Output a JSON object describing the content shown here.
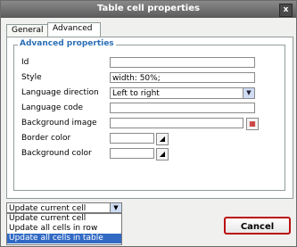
{
  "window": {
    "title": "Table cell properties",
    "close_label": "x"
  },
  "tabs": [
    {
      "label": "General"
    },
    {
      "label": "Advanced"
    }
  ],
  "advanced": {
    "section_title": "Advanced properties",
    "fields": {
      "id": {
        "label": "Id",
        "value": ""
      },
      "style": {
        "label": "Style",
        "value": "width: 50%;"
      },
      "language_direction": {
        "label": "Language direction",
        "value": "Left to right"
      },
      "language_code": {
        "label": "Language code",
        "value": ""
      },
      "background_image": {
        "label": "Background image",
        "value": ""
      },
      "border_color": {
        "label": "Border color",
        "value": ""
      },
      "background_color": {
        "label": "Background color",
        "value": ""
      }
    }
  },
  "footer": {
    "scope_select": {
      "value": "Update current cell",
      "options": [
        "Update current cell",
        "Update all cells in row",
        "Update all cells in table"
      ],
      "highlighted": "Update all cells in table"
    },
    "cancel_label": "Cancel"
  },
  "icons": {
    "close": "close-icon",
    "browse": "browse-image-icon",
    "color_picker": "color-picker-icon",
    "dropdown": "chevron-down-icon"
  }
}
